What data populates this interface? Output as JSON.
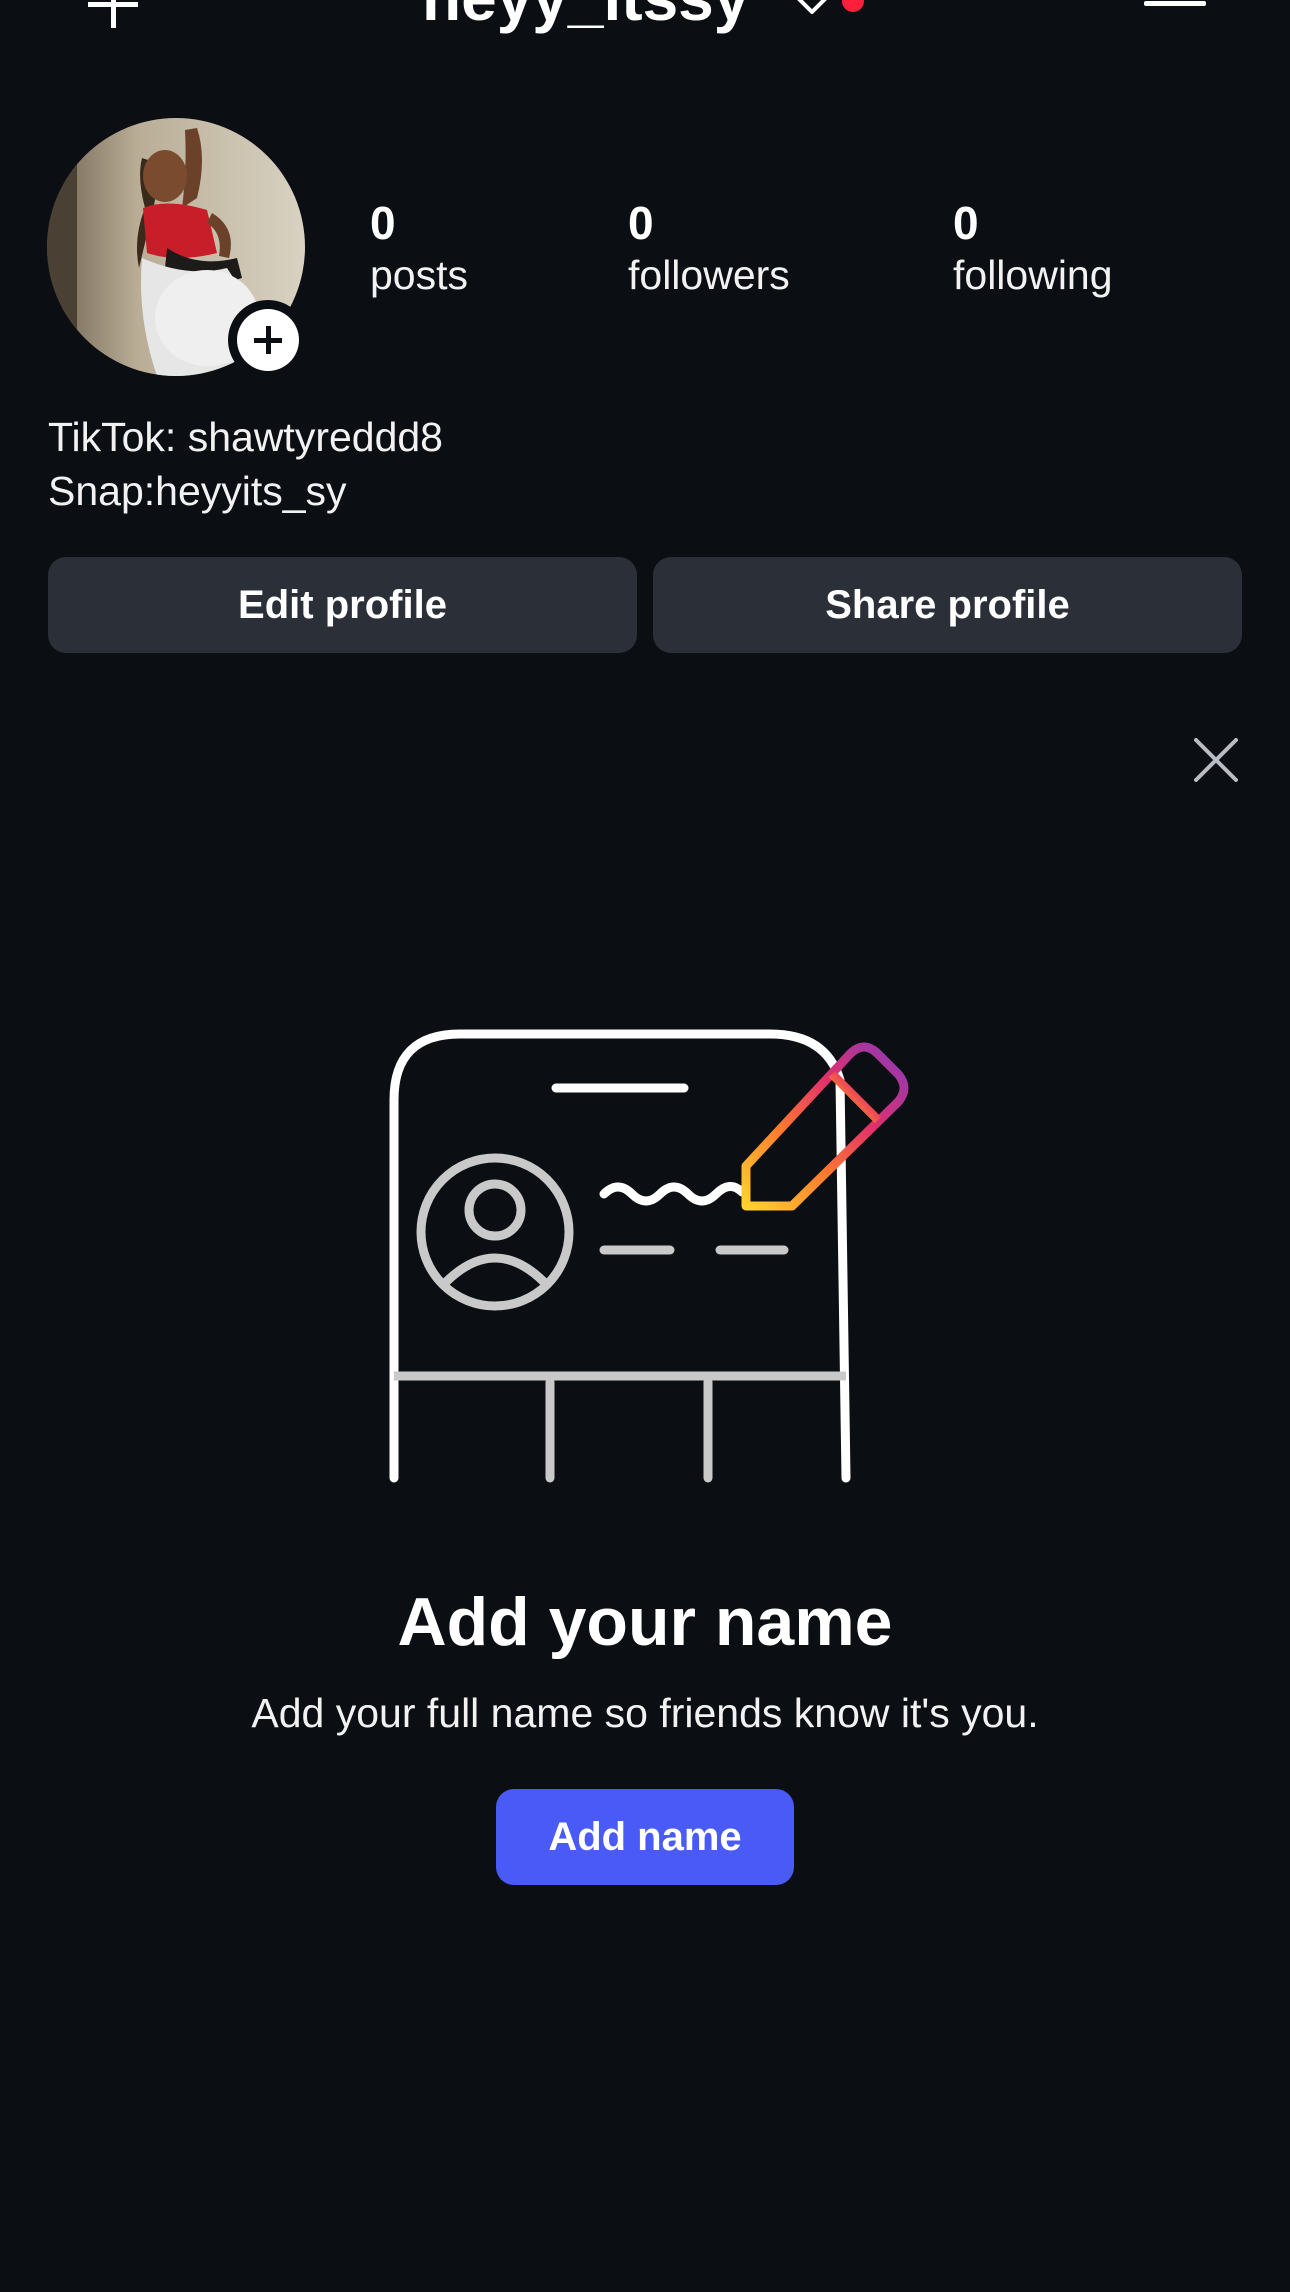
{
  "header": {
    "username": "heyy_itssy",
    "new_post_icon": "plus-icon",
    "account_switch_icon": "chevron-down-icon",
    "menu_icon": "hamburger-menu-icon",
    "notification_dot_color": "#ff1f3d"
  },
  "profile": {
    "stats": {
      "posts": {
        "value": "0",
        "label": "posts"
      },
      "followers": {
        "value": "0",
        "label": "followers"
      },
      "following": {
        "value": "0",
        "label": "following"
      }
    },
    "bio": [
      "TikTok: shawtyreddd8",
      "Snap:heyyits_sy"
    ],
    "buttons": {
      "edit": "Edit profile",
      "share": "Share profile"
    }
  },
  "add_name_card": {
    "title": "Add your name",
    "subtitle": "Add your full name so friends know it's you.",
    "button": "Add name",
    "button_color": "#4a5af7",
    "close_icon": "close-icon"
  },
  "colors": {
    "background": "#0b0e13",
    "button_bg": "#2b3038"
  }
}
